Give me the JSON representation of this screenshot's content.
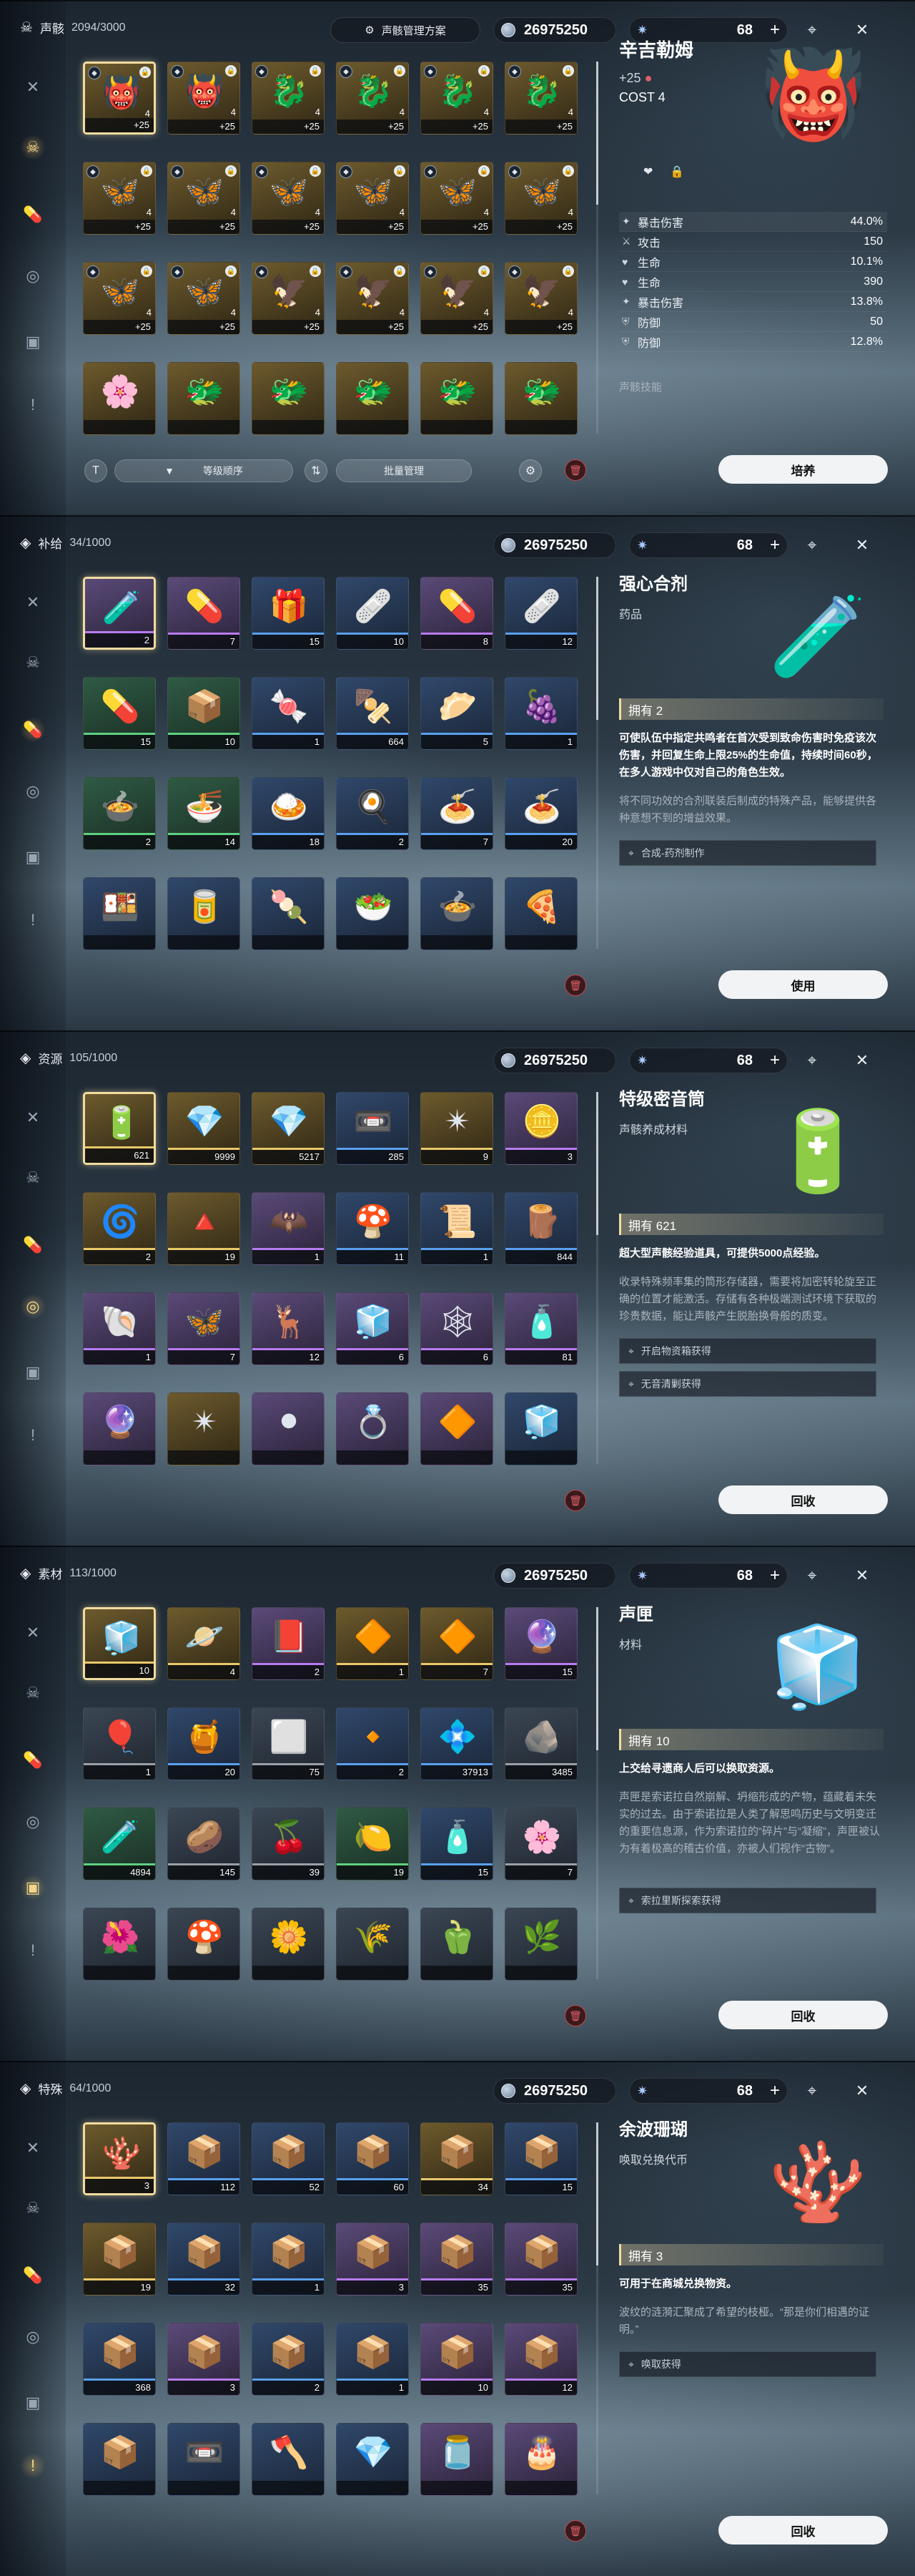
{
  "common": {
    "coins": "26975250",
    "astrite": "68"
  },
  "echo": {
    "category": "声骸",
    "count": "2094/3000",
    "plan": "声骸管理方案",
    "sort": "等级顺序",
    "batch": "批量管理",
    "action": "培养",
    "detail": {
      "name": "辛吉勒姆",
      "level": "+25",
      "cost": "COST 4",
      "skill_label": "声骸技能",
      "stats": [
        {
          "icon": "✦",
          "name": "暴击伤害",
          "value": "44.0%"
        },
        {
          "icon": "⚔",
          "name": "攻击",
          "value": "150"
        },
        {
          "icon": "♥",
          "name": "生命",
          "value": "10.1%"
        },
        {
          "icon": "♥",
          "name": "生命",
          "value": "390"
        },
        {
          "icon": "✦",
          "name": "暴击伤害",
          "value": "13.8%"
        },
        {
          "icon": "⛨",
          "name": "防御",
          "value": "50"
        },
        {
          "icon": "⛨",
          "name": "防御",
          "value": "12.8%"
        }
      ]
    },
    "items": [
      {
        "a": "👹",
        "t": "r5",
        "s": "+25",
        "c": "4",
        "sel": true
      },
      {
        "a": "👹",
        "t": "r5",
        "s": "+25",
        "c": "4"
      },
      {
        "a": "🐉",
        "t": "r5",
        "s": "+25",
        "c": "4"
      },
      {
        "a": "🐉",
        "t": "r5",
        "s": "+25",
        "c": "4"
      },
      {
        "a": "🐉",
        "t": "r5",
        "s": "+25",
        "c": "4"
      },
      {
        "a": "🐉",
        "t": "r5",
        "s": "+25",
        "c": "4"
      },
      {
        "a": "🦋",
        "t": "r5",
        "s": "+25",
        "c": "4"
      },
      {
        "a": "🦋",
        "t": "r5",
        "s": "+25",
        "c": "4"
      },
      {
        "a": "🦋",
        "t": "r5",
        "s": "+25",
        "c": "4"
      },
      {
        "a": "🦋",
        "t": "r5",
        "s": "+25",
        "c": "4"
      },
      {
        "a": "🦋",
        "t": "r5",
        "s": "+25",
        "c": "4"
      },
      {
        "a": "🦋",
        "t": "r5",
        "s": "+25",
        "c": "4"
      },
      {
        "a": "🦋",
        "t": "r5",
        "s": "+25",
        "c": "4"
      },
      {
        "a": "🦋",
        "t": "r5",
        "s": "+25",
        "c": "4"
      },
      {
        "a": "🦅",
        "t": "r5",
        "s": "+25",
        "c": "4"
      },
      {
        "a": "🦅",
        "t": "r5",
        "s": "+25",
        "c": "4"
      },
      {
        "a": "🦅",
        "t": "r5",
        "s": "+25",
        "c": "4"
      },
      {
        "a": "🦅",
        "t": "r5",
        "s": "+25",
        "c": "4"
      },
      {
        "a": "🌸",
        "t": "r5",
        "s": "",
        "c": ""
      },
      {
        "a": "🐲",
        "t": "r5",
        "s": "",
        "c": ""
      },
      {
        "a": "🐲",
        "t": "r5",
        "s": "",
        "c": ""
      },
      {
        "a": "🐲",
        "t": "r5",
        "s": "",
        "c": ""
      },
      {
        "a": "🐲",
        "t": "r5",
        "s": "",
        "c": ""
      },
      {
        "a": "🐲",
        "t": "r5",
        "s": "",
        "c": ""
      }
    ]
  },
  "supply": {
    "category": "补给",
    "count": "34/1000",
    "action": "使用",
    "detail": {
      "name": "强心合剂",
      "type": "药品",
      "art": "🧪",
      "owned": "拥有 2",
      "desc": "可使队伍中指定共鸣者在首次受到致命伤害时免疫该次伤害，并回复生命上限25%的生命值，持续时间60秒，在多人游戏中仅对自己的角色生效。",
      "lore": "将不同功效的合剂联装后制成的特殊产品，能够提供各种意想不到的增益效果。",
      "sources": [
        "合成-药剂制作"
      ]
    },
    "items": [
      {
        "a": "🧪",
        "t": "r4",
        "q": "2",
        "r": "rar-4",
        "sel": true
      },
      {
        "a": "💊",
        "t": "r4",
        "q": "7",
        "r": "rar-4"
      },
      {
        "a": "🎁",
        "t": "r3",
        "q": "15",
        "r": "rar-3"
      },
      {
        "a": "🩹",
        "t": "r3",
        "q": "10",
        "r": "rar-3"
      },
      {
        "a": "💊",
        "t": "r4",
        "q": "8",
        "r": "rar-4"
      },
      {
        "a": "🩹",
        "t": "r3",
        "q": "12",
        "r": "rar-3"
      },
      {
        "a": "💊",
        "t": "r2",
        "q": "15",
        "r": "rar-2"
      },
      {
        "a": "📦",
        "t": "r2",
        "q": "10",
        "r": "rar-2"
      },
      {
        "a": "🍬",
        "t": "r3",
        "q": "1",
        "r": "rar-3"
      },
      {
        "a": "🍢",
        "t": "r3",
        "q": "664",
        "r": "rar-3"
      },
      {
        "a": "🥟",
        "t": "r3",
        "q": "5",
        "r": "rar-3"
      },
      {
        "a": "🍇",
        "t": "r3",
        "q": "1",
        "r": "rar-3"
      },
      {
        "a": "🍲",
        "t": "r2",
        "q": "2",
        "r": "rar-2"
      },
      {
        "a": "🍜",
        "t": "r2",
        "q": "14",
        "r": "rar-2"
      },
      {
        "a": "🍛",
        "t": "r3",
        "q": "18",
        "r": "rar-3"
      },
      {
        "a": "🍳",
        "t": "r3",
        "q": "2",
        "r": "rar-3"
      },
      {
        "a": "🍝",
        "t": "r3",
        "q": "7",
        "r": "rar-3"
      },
      {
        "a": "🍝",
        "t": "r3",
        "q": "20",
        "r": "rar-3"
      },
      {
        "a": "🍱",
        "t": "r3",
        "q": "",
        "r": ""
      },
      {
        "a": "🥫",
        "t": "r3",
        "q": "",
        "r": ""
      },
      {
        "a": "🍡",
        "t": "r3",
        "q": "",
        "r": ""
      },
      {
        "a": "🥗",
        "t": "r3",
        "q": "",
        "r": ""
      },
      {
        "a": "🍲",
        "t": "r3",
        "q": "",
        "r": ""
      },
      {
        "a": "🍕",
        "t": "r3",
        "q": "",
        "r": ""
      }
    ]
  },
  "resource": {
    "category": "资源",
    "count": "105/1000",
    "action": "回收",
    "detail": {
      "name": "特级密音筒",
      "type": "声骸养成材料",
      "art": "🔋",
      "owned": "拥有 621",
      "desc": "超大型声骸经验道具，可提供5000点经验。",
      "lore": "收录特殊频率集的筒形存储器，需要将加密转轮旋至正确的位置才能激活。存储有各种极端测试环境下获取的珍贵数据，能让声骸产生脱胎换骨般的质变。",
      "sources": [
        "开启物资箱获得",
        "无音清剿获得"
      ]
    },
    "items": [
      {
        "a": "🔋",
        "t": "r5",
        "q": "621",
        "r": "rar-5",
        "sel": true
      },
      {
        "a": "💎",
        "t": "r5",
        "q": "9999",
        "r": "rar-5"
      },
      {
        "a": "💎",
        "t": "r5",
        "q": "5217",
        "r": "rar-5"
      },
      {
        "a": "📼",
        "t": "r3",
        "q": "285",
        "r": "rar-3"
      },
      {
        "a": "✴",
        "t": "r5",
        "q": "9",
        "r": "rar-5"
      },
      {
        "a": "🪙",
        "t": "r4",
        "q": "3",
        "r": "rar-4"
      },
      {
        "a": "🌀",
        "t": "r5",
        "q": "2",
        "r": "rar-5"
      },
      {
        "a": "🔺",
        "t": "r5",
        "q": "19",
        "r": "rar-5"
      },
      {
        "a": "🦇",
        "t": "r4",
        "q": "1",
        "r": "rar-4"
      },
      {
        "a": "🍄",
        "t": "r3",
        "q": "11",
        "r": "rar-3"
      },
      {
        "a": "📜",
        "t": "r3",
        "q": "1",
        "r": "rar-3"
      },
      {
        "a": "🪵",
        "t": "r3",
        "q": "844",
        "r": "rar-3"
      },
      {
        "a": "🐚",
        "t": "r4",
        "q": "1",
        "r": "rar-4"
      },
      {
        "a": "🦋",
        "t": "r4",
        "q": "7",
        "r": "rar-4"
      },
      {
        "a": "🦌",
        "t": "r4",
        "q": "12",
        "r": "rar-4"
      },
      {
        "a": "🧊",
        "t": "r4",
        "q": "6",
        "r": "rar-4"
      },
      {
        "a": "🕸",
        "t": "r4",
        "q": "6",
        "r": "rar-4"
      },
      {
        "a": "🧴",
        "t": "r4",
        "q": "81",
        "r": "rar-4"
      },
      {
        "a": "🔮",
        "t": "r4",
        "q": "",
        "r": ""
      },
      {
        "a": "✴",
        "t": "r5",
        "q": "",
        "r": ""
      },
      {
        "a": "⚫",
        "t": "r4",
        "q": "",
        "r": ""
      },
      {
        "a": "💍",
        "t": "r4",
        "q": "",
        "r": ""
      },
      {
        "a": "🔶",
        "t": "r4",
        "q": "",
        "r": ""
      },
      {
        "a": "🧊",
        "t": "r3",
        "q": "",
        "r": ""
      }
    ]
  },
  "material": {
    "category": "素材",
    "count": "113/1000",
    "action": "回收",
    "detail": {
      "name": "声匣",
      "type": "材料",
      "art": "🧊",
      "owned": "拥有 10",
      "desc": "上交给寻遗商人后可以换取资源。",
      "lore": "声匣是索诺拉自然崩解、坍缩形成的产物，蕴藏着未失实的过去。由于索诺拉是人类了解思鸣历史与文明变迁的重要信息源，作为索诺拉的“碎片”与“凝缩”，声匣被认为有着极高的稽古价值，亦被人们视作“古物”。",
      "sources": [
        "索拉里斯探索获得"
      ]
    },
    "items": [
      {
        "a": "🧊",
        "t": "r5",
        "q": "10",
        "r": "rar-5",
        "sel": true
      },
      {
        "a": "🪐",
        "t": "r5",
        "q": "4",
        "r": "rar-5"
      },
      {
        "a": "📕",
        "t": "r4",
        "q": "2",
        "r": "rar-4"
      },
      {
        "a": "🔶",
        "t": "r5",
        "q": "1",
        "r": "rar-5"
      },
      {
        "a": "🔶",
        "t": "r5",
        "q": "7",
        "r": "rar-5"
      },
      {
        "a": "🔮",
        "t": "r4",
        "q": "15",
        "r": "rar-4"
      },
      {
        "a": "🎈",
        "t": "r1",
        "q": "1",
        "r": "rar-1"
      },
      {
        "a": "🍯",
        "t": "r3",
        "q": "20",
        "r": "rar-3"
      },
      {
        "a": "⬜",
        "t": "r1",
        "q": "75",
        "r": "rar-1"
      },
      {
        "a": "🔸",
        "t": "r3",
        "q": "2",
        "r": "rar-3"
      },
      {
        "a": "💠",
        "t": "r3",
        "q": "37913",
        "r": "rar-3"
      },
      {
        "a": "🪨",
        "t": "r1",
        "q": "3485",
        "r": "rar-1"
      },
      {
        "a": "🧪",
        "t": "r2",
        "q": "4894",
        "r": "rar-2"
      },
      {
        "a": "🥔",
        "t": "r1",
        "q": "145",
        "r": "rar-1"
      },
      {
        "a": "🍒",
        "t": "r1",
        "q": "39",
        "r": "rar-1"
      },
      {
        "a": "🍋",
        "t": "r2",
        "q": "19",
        "r": "rar-2"
      },
      {
        "a": "🧴",
        "t": "r3",
        "q": "15",
        "r": "rar-3"
      },
      {
        "a": "🌸",
        "t": "r1",
        "q": "7",
        "r": "rar-1"
      },
      {
        "a": "🌺",
        "t": "r1",
        "q": "",
        "r": ""
      },
      {
        "a": "🍄",
        "t": "r1",
        "q": "",
        "r": ""
      },
      {
        "a": "🌼",
        "t": "r1",
        "q": "",
        "r": ""
      },
      {
        "a": "🌾",
        "t": "r1",
        "q": "",
        "r": ""
      },
      {
        "a": "🫑",
        "t": "r1",
        "q": "",
        "r": ""
      },
      {
        "a": "🌿",
        "t": "r1",
        "q": "",
        "r": ""
      }
    ]
  },
  "special": {
    "category": "特殊",
    "count": "64/1000",
    "action": "回收",
    "detail": {
      "name": "余波珊瑚",
      "type": "唤取兑换代币",
      "art": "🪸",
      "owned": "拥有 3",
      "desc": "可用于在商城兑换物资。",
      "lore": "波纹的涟漪汇聚成了希望的枝桠。“那是你们相遇的证明。”",
      "sources": [
        "唤取获得"
      ]
    },
    "items": [
      {
        "a": "🪸",
        "t": "r5",
        "q": "3",
        "r": "rar-5",
        "sel": true
      },
      {
        "a": "📦",
        "t": "r3",
        "q": "112",
        "r": "rar-3"
      },
      {
        "a": "📦",
        "t": "r3",
        "q": "52",
        "r": "rar-3"
      },
      {
        "a": "📦",
        "t": "r3",
        "q": "60",
        "r": "rar-3"
      },
      {
        "a": "📦",
        "t": "r5",
        "q": "34",
        "r": "rar-5"
      },
      {
        "a": "📦",
        "t": "r3",
        "q": "15",
        "r": "rar-3"
      },
      {
        "a": "📦",
        "t": "r5",
        "q": "19",
        "r": "rar-5"
      },
      {
        "a": "📦",
        "t": "r3",
        "q": "32",
        "r": "rar-3"
      },
      {
        "a": "📦",
        "t": "r3",
        "q": "1",
        "r": "rar-3"
      },
      {
        "a": "📦",
        "t": "r4",
        "q": "3",
        "r": "rar-4"
      },
      {
        "a": "📦",
        "t": "r4",
        "q": "35",
        "r": "rar-4"
      },
      {
        "a": "📦",
        "t": "r4",
        "q": "35",
        "r": "rar-4"
      },
      {
        "a": "📦",
        "t": "r3",
        "q": "368",
        "r": "rar-3"
      },
      {
        "a": "📦",
        "t": "r4",
        "q": "3",
        "r": "rar-4"
      },
      {
        "a": "📦",
        "t": "r3",
        "q": "2",
        "r": "rar-3"
      },
      {
        "a": "📦",
        "t": "r3",
        "q": "1",
        "r": "rar-3"
      },
      {
        "a": "📦",
        "t": "r4",
        "q": "10",
        "r": "rar-4"
      },
      {
        "a": "📦",
        "t": "r4",
        "q": "12",
        "r": "rar-4"
      },
      {
        "a": "📦",
        "t": "r3",
        "q": "",
        "r": ""
      },
      {
        "a": "📼",
        "t": "r3",
        "q": "",
        "r": ""
      },
      {
        "a": "🪓",
        "t": "r3",
        "q": "",
        "r": ""
      },
      {
        "a": "💎",
        "t": "r3",
        "q": "",
        "r": ""
      },
      {
        "a": "🫙",
        "t": "r4",
        "q": "",
        "r": ""
      },
      {
        "a": "🎂",
        "t": "r4",
        "q": "",
        "r": ""
      }
    ]
  }
}
